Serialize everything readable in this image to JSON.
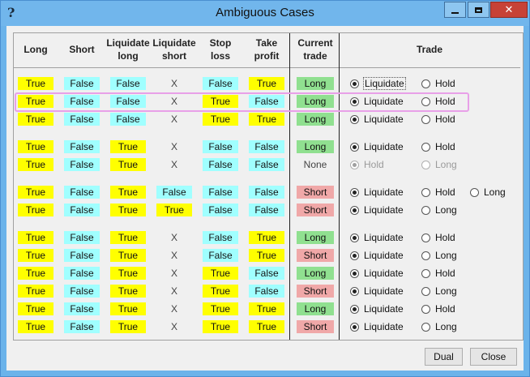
{
  "window": {
    "title": "Ambiguous Cases",
    "help_glyph": "?",
    "close_glyph": "✕"
  },
  "headers": [
    {
      "line1": "Long",
      "line2": ""
    },
    {
      "line1": "Short",
      "line2": ""
    },
    {
      "line1": "Liquidate",
      "line2": "long"
    },
    {
      "line1": "Liquidate",
      "line2": "short"
    },
    {
      "line1": "Stop",
      "line2": "loss"
    },
    {
      "line1": "Take",
      "line2": "profit"
    },
    {
      "line1": "Current",
      "line2": "trade"
    },
    {
      "line1": "Trade",
      "line2": ""
    }
  ],
  "rows": [
    {
      "long": "True",
      "short": "False",
      "liq_long": "False",
      "liq_short": "X",
      "stop": "False",
      "take": "True",
      "current": "Long",
      "options": [
        {
          "label": "Liquidate",
          "selected": true,
          "enabled": true
        },
        {
          "label": "Hold",
          "selected": false,
          "enabled": true
        }
      ]
    },
    {
      "long": "True",
      "short": "False",
      "liq_long": "False",
      "liq_short": "X",
      "stop": "True",
      "take": "False",
      "current": "Long",
      "options": [
        {
          "label": "Liquidate",
          "selected": true,
          "enabled": true
        },
        {
          "label": "Hold",
          "selected": false,
          "enabled": true
        }
      ]
    },
    {
      "long": "True",
      "short": "False",
      "liq_long": "False",
      "liq_short": "X",
      "stop": "True",
      "take": "True",
      "current": "Long",
      "options": [
        {
          "label": "Liquidate",
          "selected": true,
          "enabled": true
        },
        {
          "label": "Hold",
          "selected": false,
          "enabled": true
        }
      ]
    },
    {
      "long": "True",
      "short": "False",
      "liq_long": "True",
      "liq_short": "X",
      "stop": "False",
      "take": "False",
      "current": "Long",
      "options": [
        {
          "label": "Liquidate",
          "selected": true,
          "enabled": true
        },
        {
          "label": "Hold",
          "selected": false,
          "enabled": true
        }
      ]
    },
    {
      "long": "True",
      "short": "False",
      "liq_long": "True",
      "liq_short": "X",
      "stop": "False",
      "take": "False",
      "current": "None",
      "options": [
        {
          "label": "Hold",
          "selected": true,
          "enabled": false
        },
        {
          "label": "Long",
          "selected": false,
          "enabled": false
        }
      ]
    },
    {
      "long": "True",
      "short": "False",
      "liq_long": "True",
      "liq_short": "False",
      "stop": "False",
      "take": "False",
      "current": "Short",
      "options": [
        {
          "label": "Liquidate",
          "selected": true,
          "enabled": true
        },
        {
          "label": "Hold",
          "selected": false,
          "enabled": true
        },
        {
          "label": "Long",
          "selected": false,
          "enabled": true
        }
      ]
    },
    {
      "long": "True",
      "short": "False",
      "liq_long": "True",
      "liq_short": "True",
      "stop": "False",
      "take": "False",
      "current": "Short",
      "options": [
        {
          "label": "Liquidate",
          "selected": true,
          "enabled": true
        },
        {
          "label": "Long",
          "selected": false,
          "enabled": true
        }
      ]
    },
    {
      "long": "True",
      "short": "False",
      "liq_long": "True",
      "liq_short": "X",
      "stop": "False",
      "take": "True",
      "current": "Long",
      "options": [
        {
          "label": "Liquidate",
          "selected": true,
          "enabled": true
        },
        {
          "label": "Hold",
          "selected": false,
          "enabled": true
        }
      ]
    },
    {
      "long": "True",
      "short": "False",
      "liq_long": "True",
      "liq_short": "X",
      "stop": "False",
      "take": "True",
      "current": "Short",
      "options": [
        {
          "label": "Liquidate",
          "selected": true,
          "enabled": true
        },
        {
          "label": "Long",
          "selected": false,
          "enabled": true
        }
      ]
    },
    {
      "long": "True",
      "short": "False",
      "liq_long": "True",
      "liq_short": "X",
      "stop": "True",
      "take": "False",
      "current": "Long",
      "options": [
        {
          "label": "Liquidate",
          "selected": true,
          "enabled": true
        },
        {
          "label": "Hold",
          "selected": false,
          "enabled": true
        }
      ]
    },
    {
      "long": "True",
      "short": "False",
      "liq_long": "True",
      "liq_short": "X",
      "stop": "True",
      "take": "False",
      "current": "Short",
      "options": [
        {
          "label": "Liquidate",
          "selected": true,
          "enabled": true
        },
        {
          "label": "Long",
          "selected": false,
          "enabled": true
        }
      ]
    },
    {
      "long": "True",
      "short": "False",
      "liq_long": "True",
      "liq_short": "X",
      "stop": "True",
      "take": "True",
      "current": "Long",
      "options": [
        {
          "label": "Liquidate",
          "selected": true,
          "enabled": true
        },
        {
          "label": "Hold",
          "selected": false,
          "enabled": true
        }
      ]
    },
    {
      "long": "True",
      "short": "False",
      "liq_long": "True",
      "liq_short": "X",
      "stop": "True",
      "take": "True",
      "current": "Short",
      "options": [
        {
          "label": "Liquidate",
          "selected": true,
          "enabled": true
        },
        {
          "label": "Long",
          "selected": false,
          "enabled": true
        }
      ]
    }
  ],
  "buttons": {
    "dual": "Dual",
    "close": "Close"
  },
  "colors": {
    "true": "#ffff00",
    "false": "#a0ffff",
    "long": "#90e090",
    "short": "#f0a8a8"
  }
}
